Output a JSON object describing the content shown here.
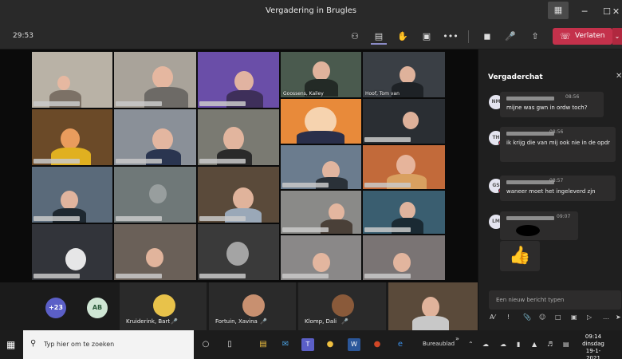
{
  "window": {
    "title": "Vergadering in Brugles",
    "controls": [
      "─",
      "☐",
      "✕"
    ]
  },
  "toolbar": {
    "timer": "29:53",
    "leave_label": "Verlaten"
  },
  "video": {
    "labeled_tiles": [
      "Goossens, Kailey",
      "Hoof, Tom van"
    ]
  },
  "participants": {
    "overflow_count": "+23",
    "avatar_initials": "AB",
    "cards": [
      "Kruiderink, Bart",
      "Fortuin, Xavina",
      "Klomp, Dali"
    ]
  },
  "chat": {
    "title": "Vergaderchat",
    "messages": [
      {
        "initials": "NM",
        "time": "08:56",
        "text": "mijne was gwn in ordw toch?"
      },
      {
        "initials": "TH",
        "time": "08:56",
        "text": "ik krijg die van mij ook nie in de opdr"
      },
      {
        "initials": "GS",
        "time": "08:57",
        "text": "waneer moet het ingeleverd zjn"
      },
      {
        "initials": "LM",
        "time": "09:07",
        "text": ""
      }
    ],
    "compose_placeholder": "Een nieuw bericht typen"
  },
  "taskbar": {
    "search_placeholder": "Typ hier om te zoeken",
    "desktop_label": "Bureaublad",
    "time": "09:14",
    "day": "dinsdag",
    "date": "19-1-2021"
  },
  "colors": {
    "leave_red": "#c4314b",
    "accent": "#8b8cc7",
    "panel": "#1f1f1f"
  }
}
